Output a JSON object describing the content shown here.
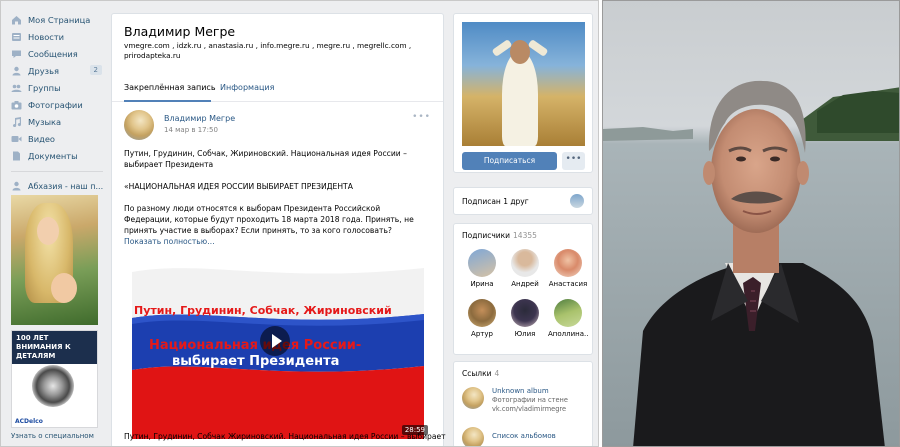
{
  "nav": {
    "items": [
      {
        "label": "Моя Страница",
        "icon": "home-icon"
      },
      {
        "label": "Новости",
        "icon": "news-icon"
      },
      {
        "label": "Сообщения",
        "icon": "messages-icon"
      },
      {
        "label": "Друзья",
        "icon": "friends-icon",
        "badge": "2"
      },
      {
        "label": "Группы",
        "icon": "groups-icon"
      },
      {
        "label": "Фотографии",
        "icon": "camera-icon"
      },
      {
        "label": "Музыка",
        "icon": "music-icon"
      },
      {
        "label": "Видео",
        "icon": "video-icon"
      },
      {
        "label": "Документы",
        "icon": "document-icon"
      }
    ],
    "ad_title": "Абхазия - наш п...",
    "ad2_headline": "100 ЛЕТ ВНИМАНИЯ К ДЕТАЛЯМ",
    "ad2_brand": "ACDelco",
    "ad_footer": "Узнать о специальном"
  },
  "profile": {
    "name": "Владимир Мегре",
    "sites": "vmegre.com , idzk.ru , anastasia.ru , info.megre.ru , megre.ru , megrellc.com , prirodapteka.ru",
    "tabs": [
      "Закреплённая запись",
      "Информация"
    ]
  },
  "post": {
    "author": "Владимир Мегре",
    "date": "14 мар в 17:50",
    "more": "•••",
    "paragraph1": "Путин, Грудинин, Собчак, Жириновский. Национальная идея России – выбирает Президента",
    "paragraph2": "«НАЦИОНАЛЬНАЯ ИДЕЯ РОССИИ ВЫБИРАЕТ ПРЕЗИДЕНТА",
    "paragraph3": "По разному люди относятся к выборам Президента Российской Федерации, которые будут проходить 18 марта 2018 года. Принять, не принять участие в выборах? Если принять, то за кого голосовать?",
    "show_more": "Показать полностью…",
    "video": {
      "line1": "Путин, Грудинин, Собчак, Жириновский",
      "line2": "Национальная идея России-",
      "line3": "выбирает Президента",
      "duration": "28:59"
    },
    "video_caption": "Путин, Грудинин, Собчак Жириновский. Национальная идея России – выбирает"
  },
  "sidebar": {
    "subscribe_label": "Подписаться",
    "more_label": "•••",
    "friend_text": "Подписан 1 друг",
    "subs_title": "Подписчики",
    "subs_count": "14355",
    "subscribers": [
      {
        "name": "Ирина"
      },
      {
        "name": "Андрей"
      },
      {
        "name": "Анастасия"
      },
      {
        "name": "Артур"
      },
      {
        "name": "Юлия"
      },
      {
        "name": "Аполлина..."
      }
    ],
    "links_title": "Ссылки",
    "links_count": "4",
    "links": [
      {
        "title": "Unknown album",
        "subtitle": "Фотографии на стене vk.com/vladimirmegre"
      },
      {
        "title": "Список альбомов",
        "subtitle": ""
      }
    ]
  },
  "colors": {
    "accent": "#5181b8",
    "link": "#2a5885",
    "background": "#edeef0"
  }
}
